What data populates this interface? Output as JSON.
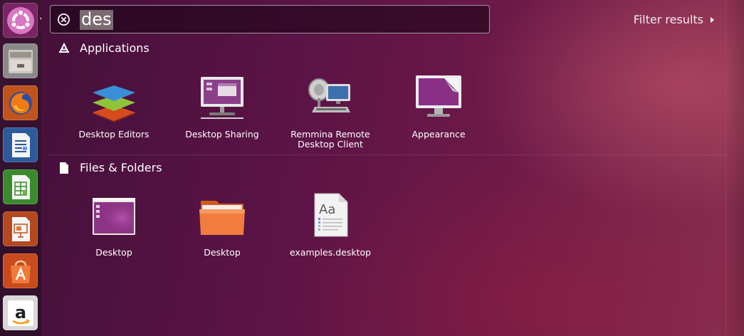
{
  "search": {
    "query": "des"
  },
  "filter": {
    "label": "Filter results"
  },
  "categories": [
    {
      "title": "Applications",
      "icon": "applications-icon",
      "items": [
        {
          "label": "Desktop Editors",
          "icon": "desktop-editors-icon"
        },
        {
          "label": "Desktop Sharing",
          "icon": "desktop-sharing-icon"
        },
        {
          "label": "Remmina Remote Desktop Client",
          "line1": "Remmina Remote",
          "line2": "Desktop Client",
          "icon": "remmina-icon"
        },
        {
          "label": "Appearance",
          "icon": "appearance-icon"
        }
      ]
    },
    {
      "title": "Files & Folders",
      "icon": "file-icon",
      "items": [
        {
          "label": "Desktop",
          "icon": "desktop-folder-icon"
        },
        {
          "label": "Desktop",
          "icon": "orange-folder-icon"
        },
        {
          "label": "examples.desktop",
          "icon": "text-file-icon"
        }
      ]
    }
  ],
  "launcher": [
    {
      "icon": "ubuntu-logo-icon"
    },
    {
      "icon": "file-manager-icon"
    },
    {
      "icon": "firefox-icon"
    },
    {
      "icon": "writer-icon"
    },
    {
      "icon": "calc-icon"
    },
    {
      "icon": "impress-icon"
    },
    {
      "icon": "software-center-icon"
    },
    {
      "icon": "amazon-icon"
    }
  ],
  "colors": {
    "accent": "#e95420",
    "selection": "#9a8c8c",
    "background": "#5b1346"
  }
}
